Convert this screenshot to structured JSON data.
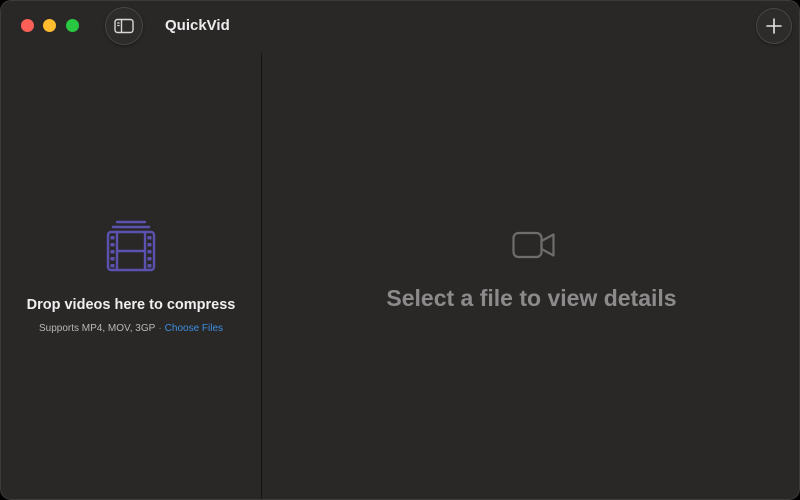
{
  "window": {
    "title": "QuickVid"
  },
  "toolbar": {
    "sidebar_toggle_icon": "sidebar-icon",
    "add_icon": "plus-icon"
  },
  "drop_zone": {
    "icon": "film-stack-icon",
    "title": "Drop videos here to compress",
    "supports_text": "Supports MP4, MOV, 3GP",
    "separator": "·",
    "choose_files_label": "Choose Files"
  },
  "detail": {
    "icon": "video-camera-icon",
    "empty_message": "Select a file to view details"
  },
  "colors": {
    "accent_link": "#3d8fe0",
    "drop_icon": "#5b52b0",
    "window_bg": "#2a2727"
  }
}
